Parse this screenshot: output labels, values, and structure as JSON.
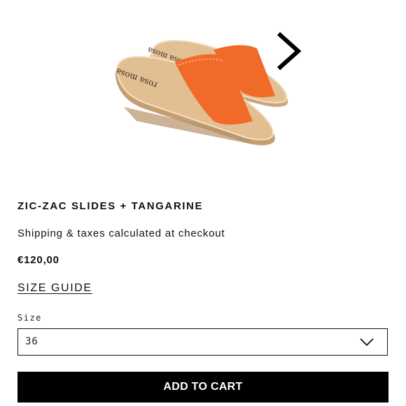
{
  "product": {
    "title": "ZIC-ZAC SLIDES + TANGARINE",
    "shipping_note": "Shipping & taxes calculated at checkout",
    "price": "€120,00",
    "size_guide_label": "SIZE GUIDE",
    "image_icon": "sandal-product-image",
    "image_brand_mark": "rosa mosa",
    "colors": {
      "strap": "#f26a2a",
      "footbed": "#e2bf92",
      "cork": "#c9a27a"
    }
  },
  "gallery": {
    "next_icon": "chevron-right-icon"
  },
  "size_selector": {
    "label": "Size",
    "selected": "36",
    "dropdown_icon": "chevron-down-icon"
  },
  "cart": {
    "add_label": "ADD TO CART"
  }
}
